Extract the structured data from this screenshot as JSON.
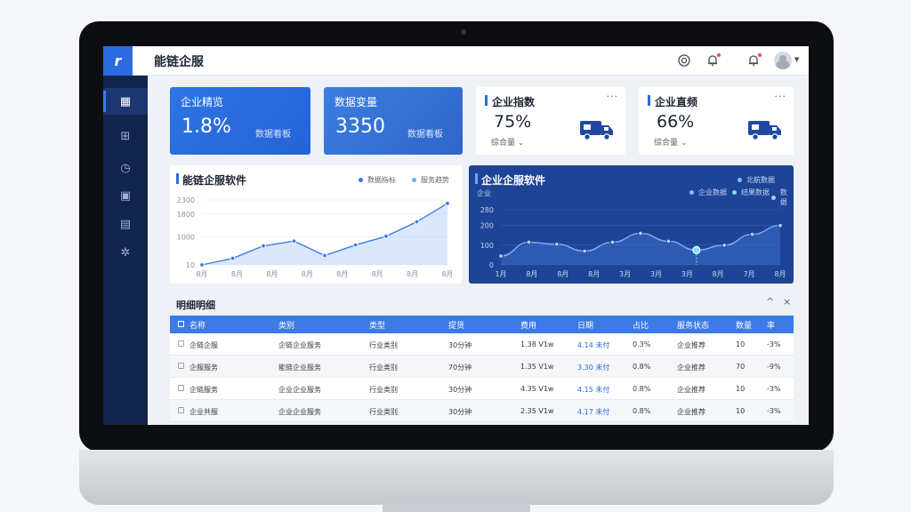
{
  "app": {
    "title": "能链企服",
    "logo_glyph": "r"
  },
  "topbar": {
    "icons": [
      "target-icon",
      "bell-icon",
      "bell-alert-icon",
      "avatar",
      "chevron-down-icon"
    ]
  },
  "sidebar": {
    "items": [
      {
        "icon": "grid-icon",
        "glyph": "▦",
        "active": true
      },
      {
        "icon": "layout-icon",
        "glyph": "⊞",
        "active": false
      },
      {
        "icon": "clock-icon",
        "glyph": "◷",
        "active": false
      },
      {
        "icon": "clipboard-icon",
        "glyph": "▣",
        "active": false
      },
      {
        "icon": "document-icon",
        "glyph": "▤",
        "active": false
      },
      {
        "icon": "settings-icon",
        "glyph": "✲",
        "active": false
      }
    ]
  },
  "kpis": [
    {
      "title": "企业精览",
      "value": "1.8%",
      "sub": "数据看板"
    },
    {
      "title": "数据变量",
      "value": "3350",
      "sub": "数据看板"
    },
    {
      "title": "企业指数",
      "value": "75%",
      "note": "综合量 ⌄",
      "more": "···"
    },
    {
      "title": "企业直频",
      "value": "66%",
      "note": "综合量 ⌄",
      "more": "···"
    }
  ],
  "colors": {
    "accent": "#2c6be0",
    "dark_panel": "#1d4496",
    "sidebar": "#12254d",
    "table_header": "#3c7ae6"
  },
  "chart_light": {
    "title": "能链企服软件",
    "legend": [
      "数据指标",
      "服务趋势"
    ],
    "y_ticks": [
      "2300",
      "1800",
      "1000",
      "10"
    ],
    "x_ticks": [
      "8月",
      "8月",
      "8月",
      "8月",
      "8月",
      "8月",
      "8月",
      "8月"
    ]
  },
  "chart_dark": {
    "title": "企业企服软件",
    "corner": "企业",
    "legend": [
      "北航数据",
      "企业数据",
      "结果数据",
      "数据"
    ],
    "y_ticks": [
      "280",
      "200",
      "100",
      "0"
    ],
    "x_ticks": [
      "1月",
      "8月",
      "8月",
      "8月",
      "3月",
      "3月",
      "3月",
      "8月",
      "7月",
      "8月"
    ]
  },
  "chart_data": [
    {
      "type": "area",
      "title": "能链企服软件",
      "x": [
        "8月",
        "8月",
        "8月",
        "8月",
        "8月",
        "8月",
        "8月",
        "8月"
      ],
      "y_ticks": [
        10,
        1000,
        1800,
        2300
      ],
      "series": [
        {
          "values": [
            10,
            240,
            680,
            850,
            340,
            710,
            1020,
            1530,
            2180
          ]
        }
      ],
      "grid": true,
      "legend": "top-right"
    },
    {
      "type": "area",
      "title": "企业企服软件",
      "x": [
        "1月",
        "8月",
        "8月",
        "8月",
        "3月",
        "3月",
        "3月",
        "8月",
        "7月",
        "8月"
      ],
      "y_ticks": [
        0,
        100,
        200,
        280
      ],
      "series": [
        {
          "values": [
            45,
            115,
            105,
            70,
            115,
            160,
            120,
            75,
            100,
            155,
            200
          ]
        }
      ],
      "grid": true,
      "legend": "top-right"
    }
  ],
  "table": {
    "title": "明细明细",
    "controls": [
      "^",
      "×"
    ],
    "headers": [
      "名称",
      "类别",
      "类型",
      "提货",
      "费用",
      "日期",
      "占比",
      "服务状态",
      "数量",
      "率"
    ],
    "rows": [
      [
        "企链企服",
        "企链企业服务",
        "行业类别",
        "30分钟",
        "1.38 V1w",
        "4.14 未付",
        "0.3%",
        "企业推荐",
        "10",
        "-3%"
      ],
      [
        "企服服务",
        "能链企业服务",
        "行业类别",
        "70分钟",
        "1.35 V1w",
        "3.30 未付",
        "0.8%",
        "企业推荐",
        "70",
        "-9%"
      ],
      [
        "企链服务",
        "企业企业服务",
        "行业类别",
        "30分钟",
        "4.35 V1w",
        "4.15 未付",
        "0.8%",
        "企业推荐",
        "10",
        "-3%"
      ],
      [
        "企业共服",
        "企业企业服务",
        "行业类别",
        "30分钟",
        "2.35 V1w",
        "4.17 未付",
        "0.8%",
        "企业推荐",
        "10",
        "-3%"
      ]
    ]
  }
}
